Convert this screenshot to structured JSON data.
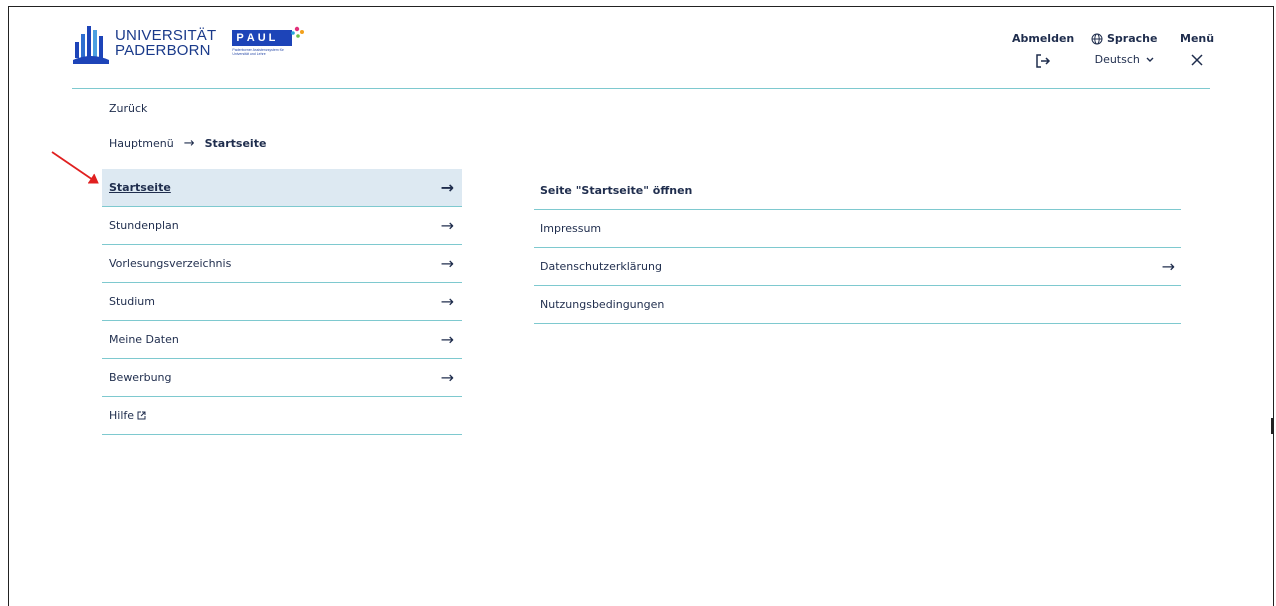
{
  "header": {
    "university_line1": "UNIVERSITÄT",
    "university_line2": "PADERBORN",
    "paul_letters": [
      "P",
      "A",
      "U",
      "L"
    ],
    "paul_subtitle": "Paderborner Assistenzsystem für Universität und Lehre",
    "logout_label": "Abmelden",
    "language_label": "Sprache",
    "language_value": "Deutsch",
    "menu_label": "Menü"
  },
  "nav": {
    "back_label": "Zurück",
    "breadcrumb": {
      "root": "Hauptmenü",
      "current": "Startseite"
    },
    "items": [
      {
        "label": "Startseite"
      },
      {
        "label": "Stundenplan"
      },
      {
        "label": "Vorlesungsverzeichnis"
      },
      {
        "label": "Studium"
      },
      {
        "label": "Meine Daten"
      },
      {
        "label": "Bewerbung"
      },
      {
        "label": "Hilfe"
      }
    ]
  },
  "submenu": {
    "items": [
      {
        "label": "Seite \"Startseite\" öffnen"
      },
      {
        "label": "Impressum"
      },
      {
        "label": "Datenschutzerklärung"
      },
      {
        "label": "Nutzungsbedingungen"
      }
    ]
  },
  "colors": {
    "accent_line": "#7ec9cf",
    "active_bg": "#dde9f2",
    "text": "#1f2d4d",
    "annotation": "#e02020"
  }
}
